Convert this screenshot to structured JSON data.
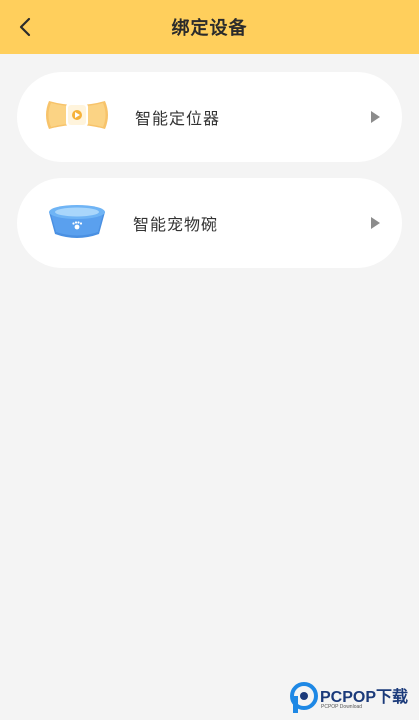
{
  "header": {
    "title": "绑定设备",
    "back_icon": "chevron-left-icon",
    "background": "#ffcf5c"
  },
  "devices": [
    {
      "label": "智能定位器",
      "icon": "locator-device-icon",
      "arrow_icon": "caret-right-icon"
    },
    {
      "label": "智能宠物碗",
      "icon": "pet-bowl-icon",
      "arrow_icon": "caret-right-icon"
    }
  ],
  "watermark": {
    "text": "PCPOP下载",
    "subtext": "PCPOP Download"
  }
}
